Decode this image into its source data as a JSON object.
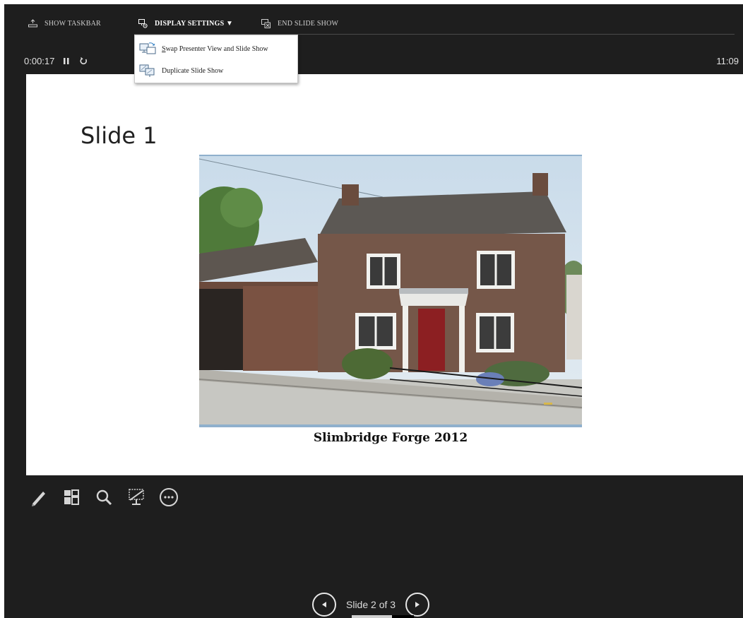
{
  "topbar": {
    "show_taskbar": "SHOW TASKBAR",
    "display_settings": "DISPLAY SETTINGS ▼",
    "end_slide_show": "END SLIDE SHOW"
  },
  "dropdown": {
    "swap_first": "S",
    "swap_rest": "wap Presenter View and Slide Show",
    "duplicate": "Duplicate Slide Show"
  },
  "timer": {
    "elapsed": "0:00:17",
    "clock": "11:09"
  },
  "slide": {
    "title": "Slide 1",
    "caption": "Slimbridge Forge 2012",
    "photo_icon": "house-photo"
  },
  "toolbar": {
    "icons": [
      "pen-icon",
      "see-all-slides-icon",
      "zoom-icon",
      "black-screen-icon",
      "more-options-icon"
    ]
  },
  "navigation": {
    "label": "Slide 2 of 3",
    "progress": 0.65
  },
  "colors": {
    "background": "#1e1e1e",
    "slide": "#ffffff",
    "text": "#d8d8d8"
  }
}
